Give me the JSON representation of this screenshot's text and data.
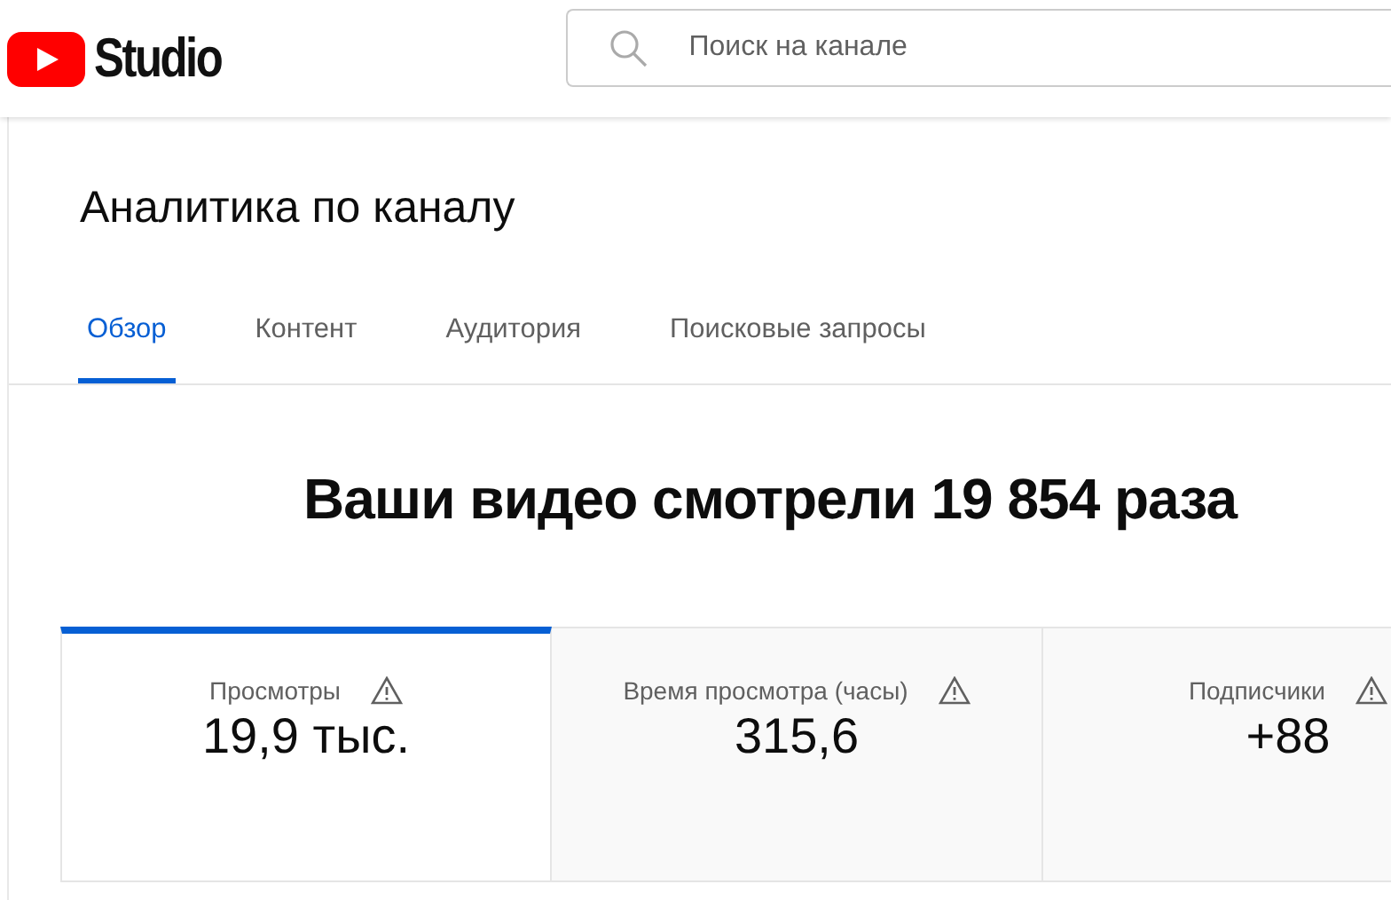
{
  "header": {
    "logo_text": "Studio",
    "search": {
      "placeholder": "Поиск на канале"
    }
  },
  "page_title": "Аналитика по каналу",
  "tabs": [
    {
      "label": "Обзор",
      "selected": true
    },
    {
      "label": "Контент",
      "selected": false
    },
    {
      "label": "Аудитория",
      "selected": false
    },
    {
      "label": "Поисковые запросы",
      "selected": false
    }
  ],
  "headline": "Ваши видео смотрели 19 854 раза",
  "metrics": [
    {
      "label": "Просмотры",
      "value": "19,9 тыс.",
      "selected": true
    },
    {
      "label": "Время просмотра (часы)",
      "value": "315,6",
      "selected": false
    },
    {
      "label": "Подписчики",
      "value": "+88",
      "selected": false
    }
  ]
}
